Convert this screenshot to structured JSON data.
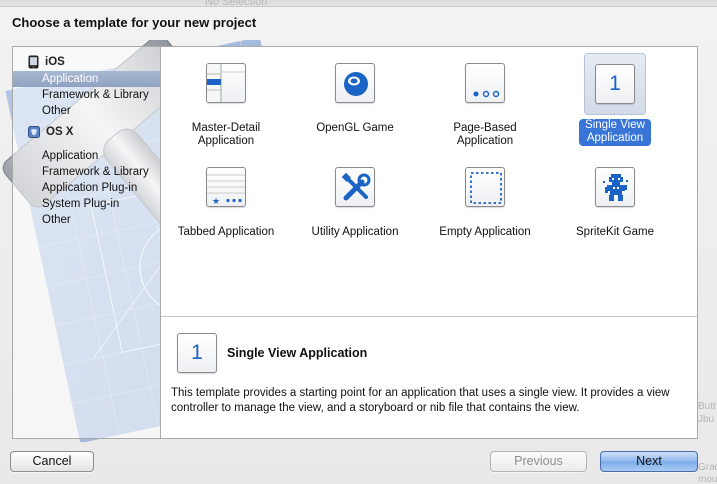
{
  "background": {
    "ghost_text": "No Selection"
  },
  "dialog": {
    "title": "Choose a template for your new project"
  },
  "sidebar": {
    "groups": [
      {
        "label": "iOS",
        "icon": "iphone-icon",
        "items": [
          "Application",
          "Framework & Library",
          "Other"
        ]
      },
      {
        "label": "OS X",
        "icon": "mac-os-x-icon",
        "items": [
          "Application",
          "Framework & Library",
          "Application Plug-in",
          "System Plug-in",
          "Other"
        ]
      }
    ],
    "selected": "iOS / Application"
  },
  "templates": [
    {
      "label": "Master-Detail\nApplication",
      "icon": "master-detail-icon"
    },
    {
      "label": "OpenGL Game",
      "icon": "opengl-sphere-icon"
    },
    {
      "label": "Page-Based\nApplication",
      "icon": "page-dots-icon"
    },
    {
      "label": "Single View\nApplication",
      "icon": "single-view-icon",
      "glyph": "1",
      "selected": true
    },
    {
      "label": "Tabbed Application",
      "icon": "tabbed-icon"
    },
    {
      "label": "Utility Application",
      "icon": "utility-tools-icon"
    },
    {
      "label": "Empty Application",
      "icon": "empty-dashed-icon"
    },
    {
      "label": "SpriteKit Game",
      "icon": "sprite-character-icon"
    }
  ],
  "description": {
    "glyph": "1",
    "title": "Single View Application",
    "body": "This template provides a starting point for an application that uses a single view. It provides a view controller to manage the view, and a storyboard or nib file that contains the view."
  },
  "buttons": {
    "cancel": "Cancel",
    "previous": "Previous",
    "next": "Next"
  },
  "edge_ghosts": [
    "Butt",
    "Jbu",
    "Gradient",
    "mouse-do"
  ],
  "colors": {
    "selection_blue": "#3875d7",
    "icon_blue": "#1b63c4",
    "sidebar_selection": "#97a9c6",
    "blueprint": "#3f6fb5"
  }
}
